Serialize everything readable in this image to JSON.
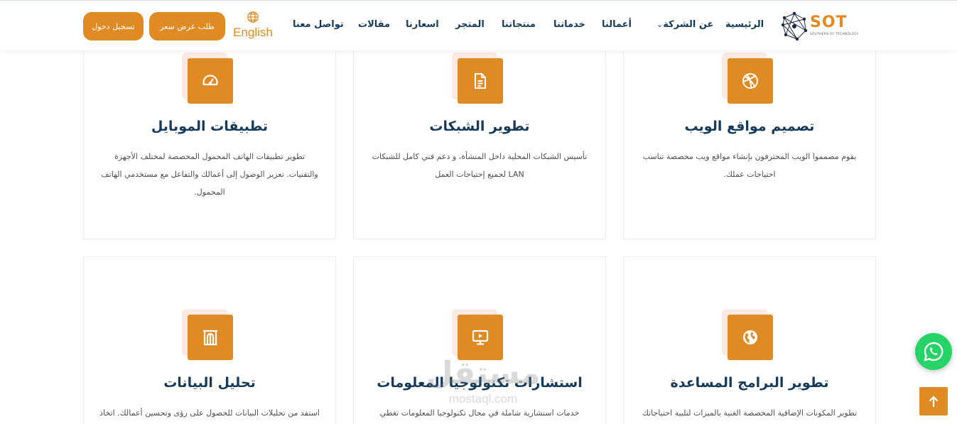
{
  "header": {
    "logo_text": "SOT",
    "logo_subtext": "SOUTHERN OF TECHNOLOGY",
    "nav": [
      {
        "label": "الرئيسية"
      },
      {
        "label": "عن الشركة",
        "has_dropdown": true
      },
      {
        "label": "أعمالنا"
      },
      {
        "label": "خدماتنا"
      },
      {
        "label": "منتجاتنا"
      },
      {
        "label": "المتجر"
      },
      {
        "label": "اسعارنا"
      },
      {
        "label": "مقالات"
      },
      {
        "label": "تواصل معنا"
      }
    ],
    "language_label": "English",
    "quote_button": "طلب عرض سعر",
    "login_button": "تسجيل دخول"
  },
  "services": [
    {
      "icon": "dribbble-icon",
      "title": "تصميم مواقع الويب",
      "description": "يقوم مصمموا الويب المحترفون بإنشاء مواقع ويب مخصصة تناسب احتياجات عملك."
    },
    {
      "icon": "document-icon",
      "title": "تطوير الشبكات",
      "description": "تأسيس الشبكات المحلية داخل المنشأة، و دعم فني كامل للشبكات LAN لجميع إحتياجات العمل"
    },
    {
      "icon": "speedometer-icon",
      "title": "تطبيقات الموبايل",
      "description": "تطوير تطبيقات الهاتف المحمول المخصصة لمختلف الأجهزة والتقنيات. تعزيز الوصول إلى أعمالك والتفاعل مع مستخدمي الهاتف المحمول."
    },
    {
      "icon": "globe-icon",
      "title": "تطوير البرامج المساعدة",
      "description": "تطوير المكونات الإضافية المخصصة الغنية بالميزات لتلبية احتياجاتك"
    },
    {
      "icon": "presentation-icon",
      "title": "استشارات تكنولوجيا المعلومات",
      "description": "خدمات استشارية شاملة في مجال تكنولوجيا المعلومات تغطي"
    },
    {
      "icon": "building-icon",
      "title": "تحليل البيانات",
      "description": "استفد من تحليلات البيانات للحصول على رؤى وتحسين أعمالك. اتخاذ"
    }
  ],
  "watermark": {
    "arabic": "مستقل",
    "latin": "mostaql.com"
  },
  "colors": {
    "accent": "#e08a24",
    "navy": "#163a5a",
    "whatsapp": "#25d366",
    "icon_shadow": "#fbe9e3"
  }
}
